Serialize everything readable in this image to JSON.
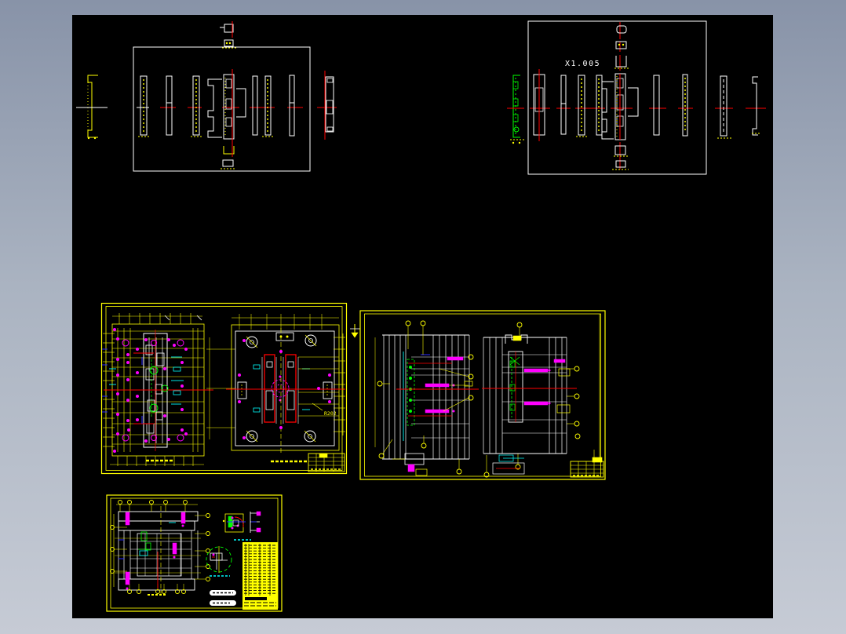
{
  "frame": {
    "top_color": "#8893a8",
    "mid_color": "#aab3c1",
    "bottom_color": "#c6cbd5"
  },
  "canvas": {
    "background": "#000000"
  },
  "palette": {
    "white": "#ffffff",
    "yellow": "#ffff00",
    "red": "#ff0000",
    "magenta": "#ff00ff",
    "cyan": "#00ffff",
    "green": "#00ff00",
    "blue": "#2a2aff",
    "black": "#000000"
  },
  "labels": {
    "top_right_drawing_number": "X1.005",
    "plan_sheet_radius_note": "R202"
  }
}
